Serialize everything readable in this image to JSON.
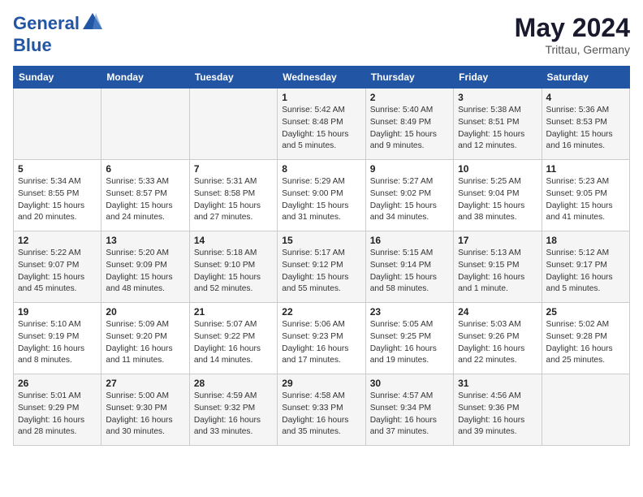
{
  "header": {
    "logo_line1": "General",
    "logo_line2": "Blue",
    "month_year": "May 2024",
    "location": "Trittau, Germany"
  },
  "calendar": {
    "days_of_week": [
      "Sunday",
      "Monday",
      "Tuesday",
      "Wednesday",
      "Thursday",
      "Friday",
      "Saturday"
    ],
    "weeks": [
      [
        {
          "day": "",
          "info": ""
        },
        {
          "day": "",
          "info": ""
        },
        {
          "day": "",
          "info": ""
        },
        {
          "day": "1",
          "info": "Sunrise: 5:42 AM\nSunset: 8:48 PM\nDaylight: 15 hours\nand 5 minutes."
        },
        {
          "day": "2",
          "info": "Sunrise: 5:40 AM\nSunset: 8:49 PM\nDaylight: 15 hours\nand 9 minutes."
        },
        {
          "day": "3",
          "info": "Sunrise: 5:38 AM\nSunset: 8:51 PM\nDaylight: 15 hours\nand 12 minutes."
        },
        {
          "day": "4",
          "info": "Sunrise: 5:36 AM\nSunset: 8:53 PM\nDaylight: 15 hours\nand 16 minutes."
        }
      ],
      [
        {
          "day": "5",
          "info": "Sunrise: 5:34 AM\nSunset: 8:55 PM\nDaylight: 15 hours\nand 20 minutes."
        },
        {
          "day": "6",
          "info": "Sunrise: 5:33 AM\nSunset: 8:57 PM\nDaylight: 15 hours\nand 24 minutes."
        },
        {
          "day": "7",
          "info": "Sunrise: 5:31 AM\nSunset: 8:58 PM\nDaylight: 15 hours\nand 27 minutes."
        },
        {
          "day": "8",
          "info": "Sunrise: 5:29 AM\nSunset: 9:00 PM\nDaylight: 15 hours\nand 31 minutes."
        },
        {
          "day": "9",
          "info": "Sunrise: 5:27 AM\nSunset: 9:02 PM\nDaylight: 15 hours\nand 34 minutes."
        },
        {
          "day": "10",
          "info": "Sunrise: 5:25 AM\nSunset: 9:04 PM\nDaylight: 15 hours\nand 38 minutes."
        },
        {
          "day": "11",
          "info": "Sunrise: 5:23 AM\nSunset: 9:05 PM\nDaylight: 15 hours\nand 41 minutes."
        }
      ],
      [
        {
          "day": "12",
          "info": "Sunrise: 5:22 AM\nSunset: 9:07 PM\nDaylight: 15 hours\nand 45 minutes."
        },
        {
          "day": "13",
          "info": "Sunrise: 5:20 AM\nSunset: 9:09 PM\nDaylight: 15 hours\nand 48 minutes."
        },
        {
          "day": "14",
          "info": "Sunrise: 5:18 AM\nSunset: 9:10 PM\nDaylight: 15 hours\nand 52 minutes."
        },
        {
          "day": "15",
          "info": "Sunrise: 5:17 AM\nSunset: 9:12 PM\nDaylight: 15 hours\nand 55 minutes."
        },
        {
          "day": "16",
          "info": "Sunrise: 5:15 AM\nSunset: 9:14 PM\nDaylight: 15 hours\nand 58 minutes."
        },
        {
          "day": "17",
          "info": "Sunrise: 5:13 AM\nSunset: 9:15 PM\nDaylight: 16 hours\nand 1 minute."
        },
        {
          "day": "18",
          "info": "Sunrise: 5:12 AM\nSunset: 9:17 PM\nDaylight: 16 hours\nand 5 minutes."
        }
      ],
      [
        {
          "day": "19",
          "info": "Sunrise: 5:10 AM\nSunset: 9:19 PM\nDaylight: 16 hours\nand 8 minutes."
        },
        {
          "day": "20",
          "info": "Sunrise: 5:09 AM\nSunset: 9:20 PM\nDaylight: 16 hours\nand 11 minutes."
        },
        {
          "day": "21",
          "info": "Sunrise: 5:07 AM\nSunset: 9:22 PM\nDaylight: 16 hours\nand 14 minutes."
        },
        {
          "day": "22",
          "info": "Sunrise: 5:06 AM\nSunset: 9:23 PM\nDaylight: 16 hours\nand 17 minutes."
        },
        {
          "day": "23",
          "info": "Sunrise: 5:05 AM\nSunset: 9:25 PM\nDaylight: 16 hours\nand 19 minutes."
        },
        {
          "day": "24",
          "info": "Sunrise: 5:03 AM\nSunset: 9:26 PM\nDaylight: 16 hours\nand 22 minutes."
        },
        {
          "day": "25",
          "info": "Sunrise: 5:02 AM\nSunset: 9:28 PM\nDaylight: 16 hours\nand 25 minutes."
        }
      ],
      [
        {
          "day": "26",
          "info": "Sunrise: 5:01 AM\nSunset: 9:29 PM\nDaylight: 16 hours\nand 28 minutes."
        },
        {
          "day": "27",
          "info": "Sunrise: 5:00 AM\nSunset: 9:30 PM\nDaylight: 16 hours\nand 30 minutes."
        },
        {
          "day": "28",
          "info": "Sunrise: 4:59 AM\nSunset: 9:32 PM\nDaylight: 16 hours\nand 33 minutes."
        },
        {
          "day": "29",
          "info": "Sunrise: 4:58 AM\nSunset: 9:33 PM\nDaylight: 16 hours\nand 35 minutes."
        },
        {
          "day": "30",
          "info": "Sunrise: 4:57 AM\nSunset: 9:34 PM\nDaylight: 16 hours\nand 37 minutes."
        },
        {
          "day": "31",
          "info": "Sunrise: 4:56 AM\nSunset: 9:36 PM\nDaylight: 16 hours\nand 39 minutes."
        },
        {
          "day": "",
          "info": ""
        }
      ]
    ]
  }
}
